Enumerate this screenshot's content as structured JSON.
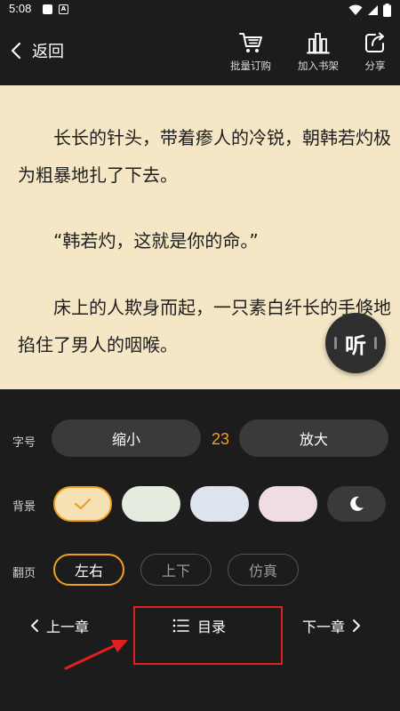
{
  "status_bar": {
    "time": "5:08"
  },
  "header": {
    "back_label": "返回",
    "actions": [
      {
        "icon": "cart-icon",
        "label": "批量订购"
      },
      {
        "icon": "bookshelf-icon",
        "label": "加入书架"
      },
      {
        "icon": "share-icon",
        "label": "分享"
      }
    ]
  },
  "reader": {
    "paragraphs": [
      "长长的针头，带着瘆人的冷锐，朝韩若灼极为粗暴地扎了下去。",
      "“韩若灼，这就是你的命。”",
      "床上的人欺身而起，一只素白纤长的手倏地掐住了男人的咽喉。"
    ],
    "listen_label": "听",
    "background_color": "#f5e7c5"
  },
  "settings": {
    "font_size": {
      "label": "字号",
      "decrease_label": "缩小",
      "value": "23",
      "increase_label": "放大"
    },
    "background": {
      "label": "背景",
      "swatches": [
        {
          "name": "cream",
          "color": "#f5e1b4",
          "selected": true
        },
        {
          "name": "green",
          "color": "#e3ecdf",
          "selected": false
        },
        {
          "name": "blue",
          "color": "#dde3ef",
          "selected": false
        },
        {
          "name": "pink",
          "color": "#efdde1",
          "selected": false
        },
        {
          "name": "night",
          "color": "#3a3a3a",
          "selected": false
        }
      ]
    },
    "page_turn": {
      "label": "翻页",
      "modes": [
        {
          "label": "左右",
          "active": true
        },
        {
          "label": "上下",
          "active": false
        },
        {
          "label": "仿真",
          "active": false
        }
      ]
    },
    "nav": {
      "prev_label": "上一章",
      "toc_label": "目录",
      "next_label": "下一章"
    }
  },
  "colors": {
    "accent": "#f0a020",
    "panel_bg": "#1c1c1c",
    "pill_bg": "#3a3a3a",
    "annotation": "#e02020"
  }
}
